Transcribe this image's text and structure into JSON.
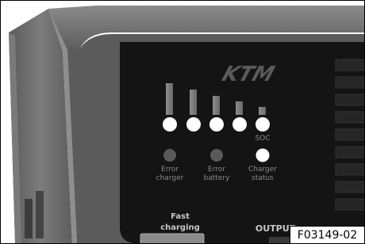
{
  "brand": {
    "logo_text": "KTM"
  },
  "soc": {
    "label": "SOC",
    "led_count": 5,
    "levels": [
      1.0,
      0.75,
      0.55,
      0.35,
      0.12
    ],
    "led_color": "#ffffff"
  },
  "indicators": [
    {
      "line1": "Error",
      "line2": "charger",
      "lit": false
    },
    {
      "line1": "Error",
      "line2": "battery",
      "lit": false
    },
    {
      "line1": "Charger",
      "line2": "status",
      "lit": true
    }
  ],
  "controls": {
    "fast_charging_line1": "Fast",
    "fast_charging_line2": "charging",
    "output_label": "OUTPUT"
  },
  "figure_id": "F03149-02",
  "colors": {
    "housing": "#6e6e6e",
    "housing_dark": "#4a4a4a",
    "panel": "#141414",
    "led_off": "#5a5a5a",
    "label": "#8a8a8a"
  }
}
